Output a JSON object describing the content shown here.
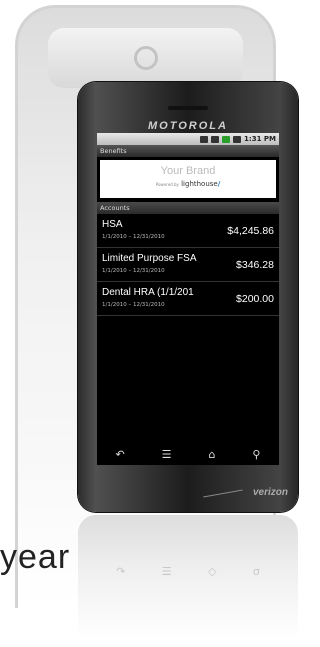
{
  "phone": {
    "brand": "MOTOROLA",
    "carrier": "verizon",
    "status_time": "1:31 PM"
  },
  "app": {
    "title": "Benefits",
    "banner_brand": "Your Brand",
    "powered_by": "Powered by",
    "powered_name": "lighthouse",
    "section_title": "Accounts"
  },
  "accounts": [
    {
      "name": "HSA",
      "dates": "1/1/2010 – 12/31/2010",
      "amount": "$4,245.86"
    },
    {
      "name": "Limited Purpose FSA",
      "dates": "1/1/2010 – 12/31/2010",
      "amount": "$346.28"
    },
    {
      "name": "Dental HRA (1/1/201",
      "dates": "1/1/2010 – 12/31/2010",
      "amount": "$200.00"
    }
  ],
  "navbar": {
    "back_icon": "↶",
    "menu_icon": "☰",
    "home_icon": "⌂",
    "search_icon": "⚲"
  },
  "side_text": "year"
}
